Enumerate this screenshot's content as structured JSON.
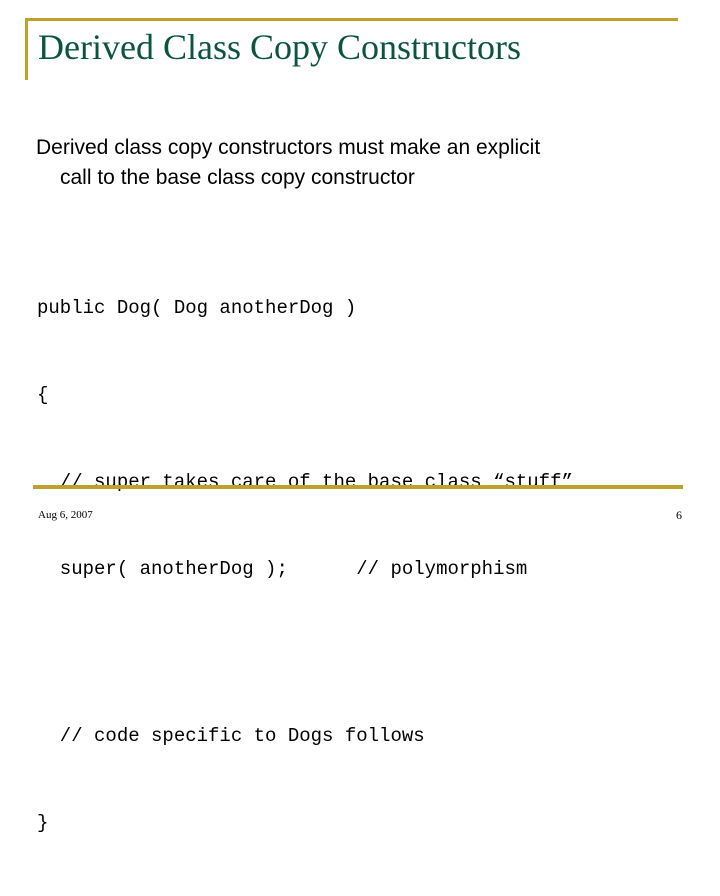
{
  "slide": {
    "title": "Derived Class Copy Constructors",
    "accent_color": "#c0a02c",
    "title_color": "#0b5440",
    "background_color": "#ffffff",
    "body": {
      "line1": "Derived class copy constructors must make an explicit",
      "line2": "call to the base class copy constructor"
    },
    "code": {
      "line1": "public Dog( Dog anotherDog )",
      "line2": "{",
      "line3": "  // super takes care of the base class “stuff”",
      "line4": "  super( anotherDog );      // polymorphism",
      "line5": "",
      "line6": "  // code specific to Dogs follows",
      "line7": "}"
    },
    "footer": {
      "date": "Aug 6, 2007",
      "page_number": "6"
    }
  }
}
